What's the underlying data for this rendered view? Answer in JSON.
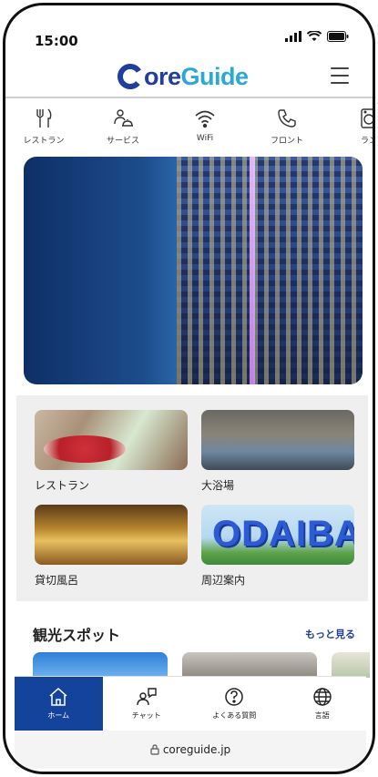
{
  "status_bar": {
    "time": "15:00"
  },
  "header": {
    "logo_part1": "C",
    "logo_part2": "ore",
    "logo_part3": "Guide"
  },
  "quick_nav": [
    {
      "label": "レストラン",
      "icon": "fork-knife-icon"
    },
    {
      "label": "サービス",
      "icon": "service-bell-icon"
    },
    {
      "label": "WiFi",
      "icon": "wifi-icon"
    },
    {
      "label": "フロント",
      "icon": "phone-icon"
    },
    {
      "label": "ラン",
      "icon": "laundry-icon"
    }
  ],
  "grid": [
    {
      "label": "レストラン"
    },
    {
      "label": "大浴場"
    },
    {
      "label": "貸切風呂"
    },
    {
      "label": "周辺案内",
      "image_text": "ODAIBA"
    }
  ],
  "spots": {
    "title": "観光スポット",
    "more": "もっと見る"
  },
  "tabbar": [
    {
      "label": "ホーム",
      "icon": "home-icon",
      "active": true
    },
    {
      "label": "チャット",
      "icon": "chat-icon",
      "active": false
    },
    {
      "label": "よくある質問",
      "icon": "question-icon",
      "active": false
    },
    {
      "label": "言語",
      "icon": "globe-icon",
      "active": false
    }
  ],
  "url_bar": {
    "url": "coreguide.jp"
  },
  "colors": {
    "brand": "#1f3f9b",
    "accent": "#2aa8d6",
    "tab_active": "#14439b"
  }
}
